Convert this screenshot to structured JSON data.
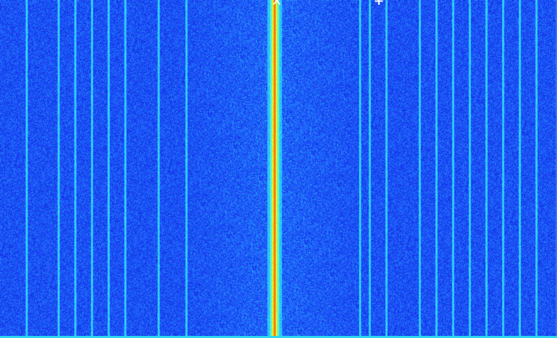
{
  "waterfall": {
    "background": "#0a1fd0",
    "palette": [
      "#0716c8",
      "#1a3cf0",
      "#2f7dff",
      "#28c8ff",
      "#3cf0ff",
      "#7cff8c",
      "#f0ff30",
      "#ffb000",
      "#ff4a00"
    ],
    "carrier_color": "#f2ff1a",
    "carrier_core_color": "#ff7a00",
    "markers": {
      "tuned_icon": "x-icon",
      "tuned_glyph": "✕",
      "secondary_icon": "plus-icon",
      "secondary_glyph": "+"
    }
  }
}
